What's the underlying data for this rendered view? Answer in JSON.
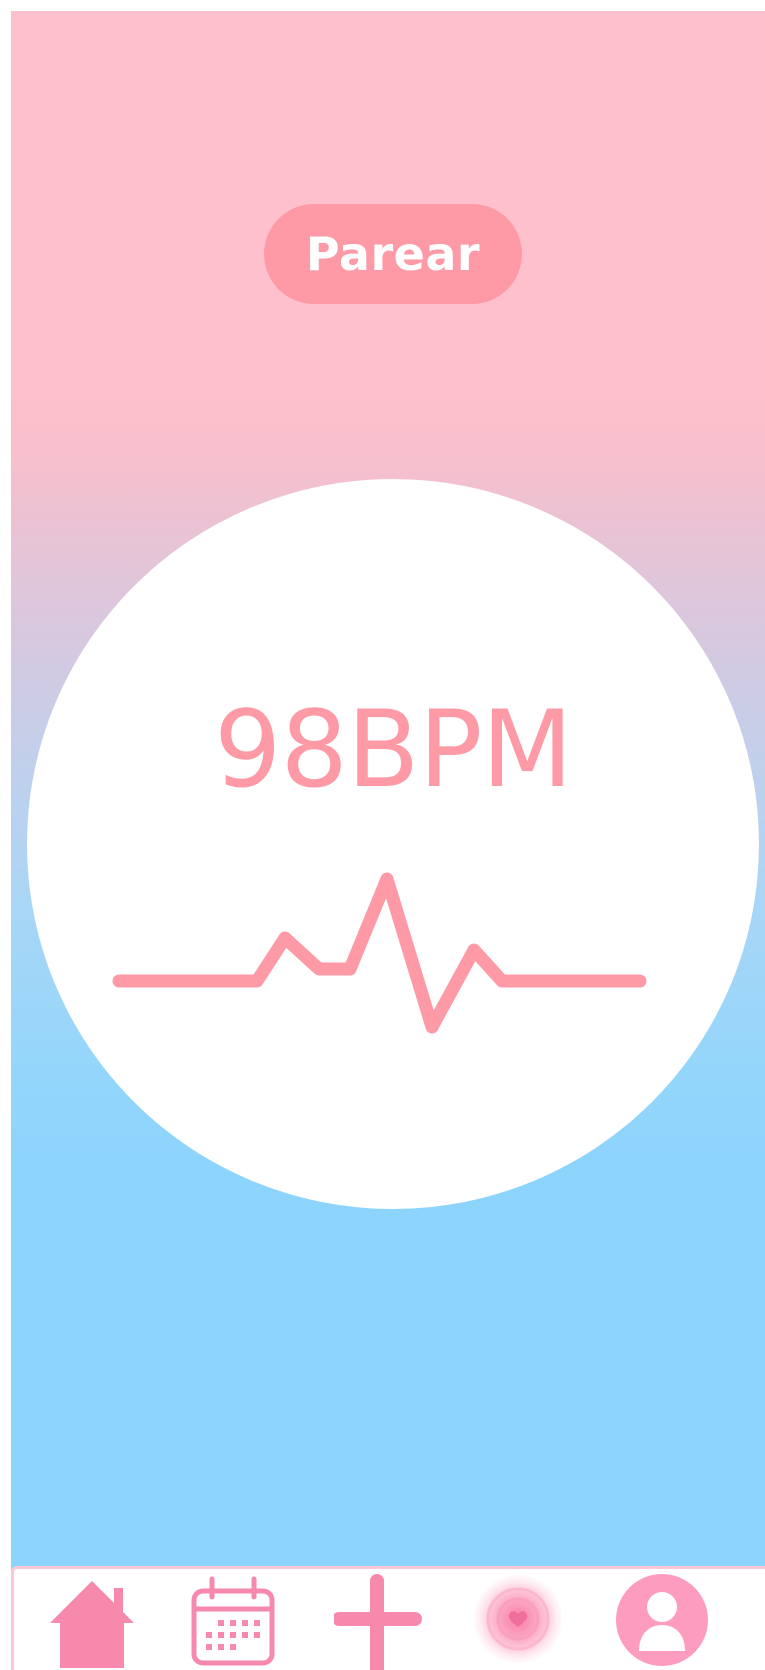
{
  "pair_button": {
    "label": "Parear"
  },
  "monitor": {
    "bpm_value": "98BPM"
  },
  "bottom_nav": {
    "items": [
      {
        "icon": "home-icon"
      },
      {
        "icon": "calendar-icon"
      },
      {
        "icon": "plus-icon"
      },
      {
        "icon": "heart-pulse-icon"
      },
      {
        "icon": "profile-icon"
      }
    ]
  },
  "colors": {
    "accent": "#fe9aa6",
    "nav_icon": "#f78aac",
    "top_gradient": "#fec0cc",
    "bottom_gradient": "#8dd4fd"
  }
}
